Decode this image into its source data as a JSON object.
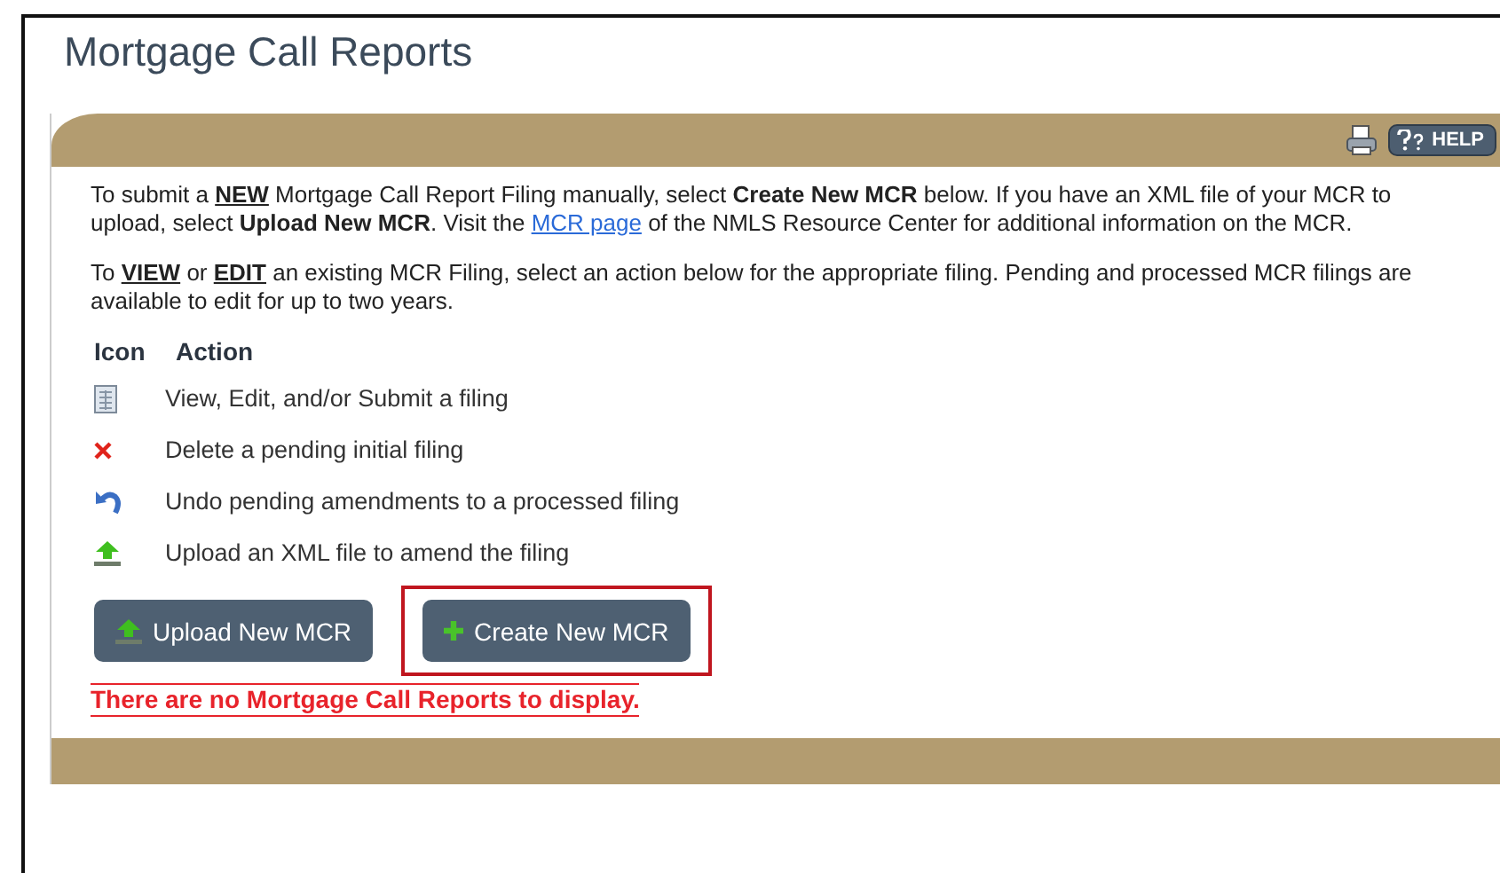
{
  "page_title": "Mortgage Call Reports",
  "toolbar": {
    "help_label": "HELP"
  },
  "paragraphs": [
    [
      {
        "kind": "plain",
        "text": "To submit a "
      },
      {
        "kind": "key",
        "text": "NEW"
      },
      {
        "kind": "plain",
        "text": " Mortgage Call Report Filing manually, select "
      },
      {
        "kind": "bold",
        "text": "Create New MCR"
      },
      {
        "kind": "plain",
        "text": " below. If you have an XML file of your MCR to upload, select "
      },
      {
        "kind": "bold",
        "text": "Upload New MCR"
      },
      {
        "kind": "plain",
        "text": ". Visit the "
      },
      {
        "kind": "link",
        "text": "MCR page"
      },
      {
        "kind": "plain",
        "text": " of the NMLS Resource Center for additional information on the MCR."
      }
    ],
    [
      {
        "kind": "plain",
        "text": "To "
      },
      {
        "kind": "key",
        "text": "VIEW"
      },
      {
        "kind": "plain",
        "text": " or "
      },
      {
        "kind": "key",
        "text": "EDIT"
      },
      {
        "kind": "plain",
        "text": " an existing MCR Filing, select an action below for the appropriate filing. Pending and processed MCR filings are available to edit for up to two years."
      }
    ]
  ],
  "legend": {
    "columns": [
      "Icon",
      "Action"
    ],
    "rows": [
      {
        "kind": "document",
        "action": "View, Edit, and/or Submit a filing"
      },
      {
        "kind": "delete",
        "action": "Delete a pending initial filing"
      },
      {
        "kind": "undo",
        "action": "Undo pending amendments to a processed filing"
      },
      {
        "kind": "upload",
        "action": "Upload an XML file to amend the filing"
      }
    ]
  },
  "buttons": [
    {
      "kind": "upload",
      "label": "Upload New MCR",
      "highlighted": false
    },
    {
      "kind": "plus",
      "label": "Create New MCR",
      "highlighted": true
    }
  ],
  "empty_message": "There are no Mortgage Call Reports to display."
}
